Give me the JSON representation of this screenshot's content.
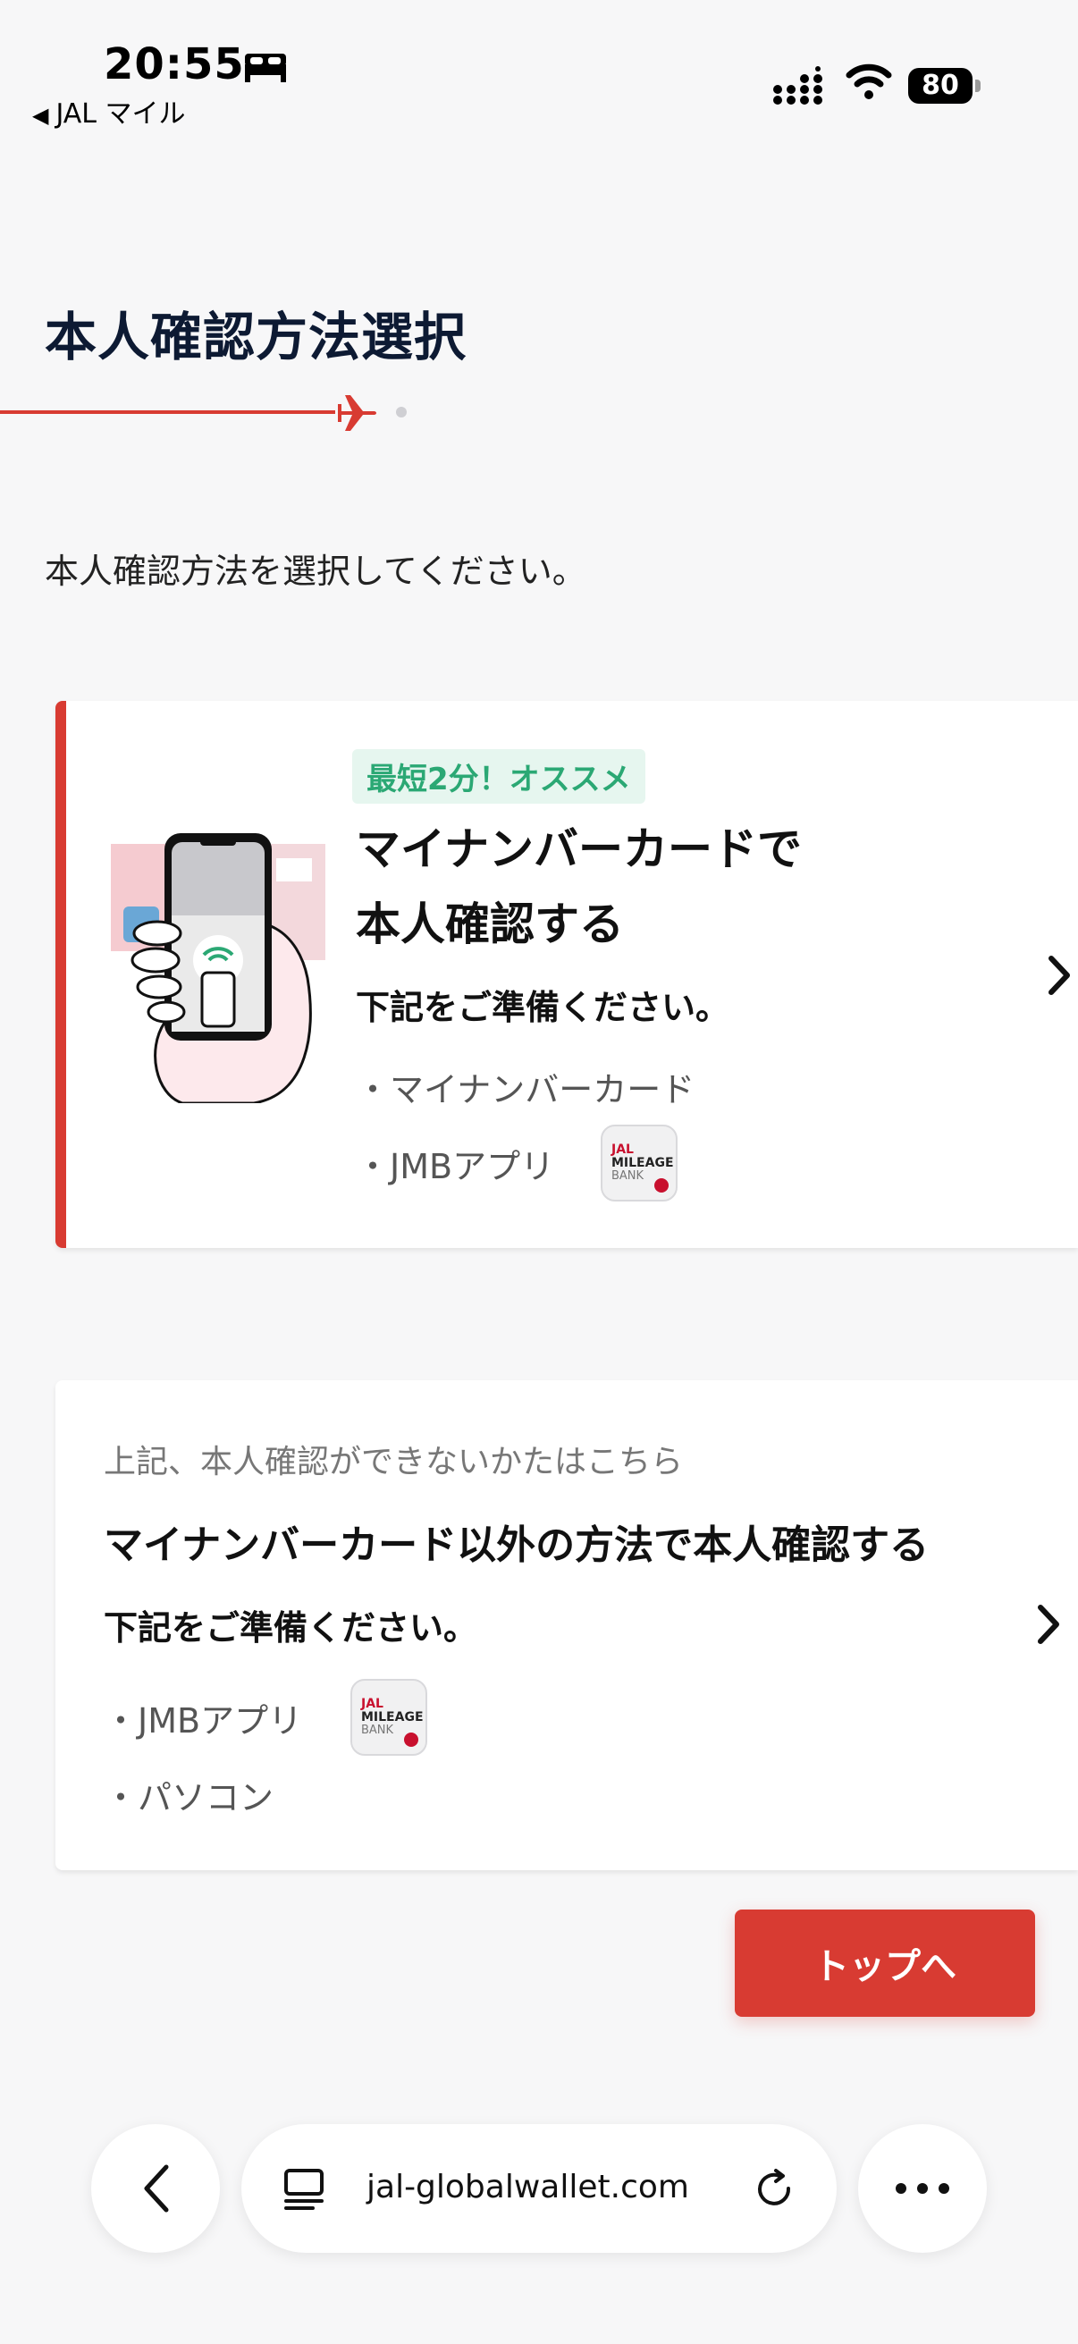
{
  "status_bar": {
    "time": "20:55",
    "back_app": "JAL マイル",
    "battery": "80"
  },
  "header": {
    "title": "本人確認方法選択"
  },
  "instruction": "本人確認方法を選択してください。",
  "card_mynumber": {
    "badge": "最短2分！オススメ",
    "title_line1": "マイナンバーカードで",
    "title_line2": "本人確認する",
    "prep_label": "下記をご準備ください。",
    "item1": "・マイナンバーカード",
    "item2": "・JMBアプリ"
  },
  "card_other": {
    "note": "上記、本人確認ができないかたはこちら",
    "title": "マイナンバーカード以外の方法で本人確認する",
    "prep_label": "下記をご準備ください。",
    "item1": "・JMBアプリ",
    "item2": "・パソコン"
  },
  "app_icon": {
    "line1": "JAL",
    "line2": "MILEAGE",
    "line3": "BANK"
  },
  "top_button": "トップへ",
  "browser": {
    "url": "jal-globalwallet.com"
  },
  "colors": {
    "accent": "#d83b32",
    "badge_bg": "#e6f6ef",
    "badge_text": "#2ba874",
    "title": "#0d1a33"
  },
  "icons": [
    "bed-icon",
    "signal-icon",
    "wifi-icon",
    "airplane-icon",
    "chevron-right-icon",
    "back-chevron-icon",
    "tabs-icon",
    "reload-icon",
    "more-icon"
  ]
}
